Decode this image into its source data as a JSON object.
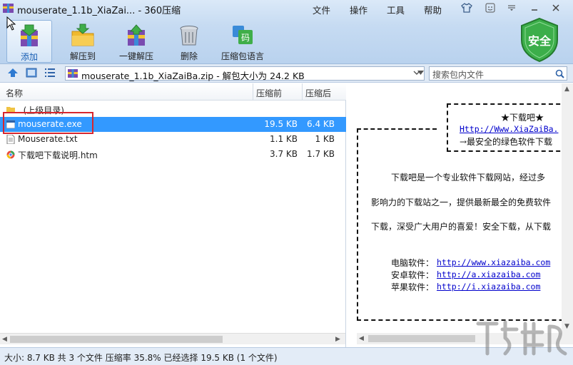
{
  "window": {
    "title": "mouserate_1.1b_XiaZai... - 360压缩",
    "menus": [
      "文件",
      "操作",
      "工具",
      "帮助"
    ]
  },
  "toolbar": {
    "buttons": [
      {
        "label": "添加",
        "icon": "add-icon"
      },
      {
        "label": "解压到",
        "icon": "extract-to-icon"
      },
      {
        "label": "一键解压",
        "icon": "one-click-extract-icon"
      },
      {
        "label": "删除",
        "icon": "delete-icon"
      },
      {
        "label": "压缩包语言",
        "icon": "archive-language-icon"
      }
    ],
    "shield_label": "安全"
  },
  "address": {
    "path": "mouserate_1.1b_XiaZaiBa.zip - 解包大小为 24.2 KB",
    "search_placeholder": "搜索包内文件"
  },
  "list": {
    "headers": {
      "name": "名称",
      "size": "压缩前",
      "csize": "压缩后"
    },
    "rows": [
      {
        "name": "..(上级目录)",
        "size": "",
        "csize": "",
        "icon": "folder-icon"
      },
      {
        "name": "mouserate.exe",
        "size": "19.5 KB",
        "csize": "6.4 KB",
        "icon": "exe-icon"
      },
      {
        "name": "Mouserate.txt",
        "size": "1.1 KB",
        "csize": "1 KB",
        "icon": "txt-icon"
      },
      {
        "name": "下载吧下载说明.htm",
        "size": "3.7 KB",
        "csize": "1.7 KB",
        "icon": "htm-icon"
      }
    ]
  },
  "preview": {
    "box_title": "★下载吧★",
    "box_url": "Http://Www.XiaZaiBa.",
    "box_slogan": "→最安全的绿色软件下载",
    "para1": "下载吧是一个专业软件下载网站，经过多",
    "para2": "影响力的下载站之一，提供最新最全的免费软件",
    "para3": "下载，深受广大用户的喜爱！安全下载，从下载",
    "links": [
      {
        "label": "电脑软件：",
        "url": "http://www.xiazaiba.com"
      },
      {
        "label": "安卓软件：",
        "url": "http://a.xiazaiba.com"
      },
      {
        "label": "苹果软件：",
        "url": "http://i.xiazaiba.com"
      }
    ]
  },
  "status": "大小: 8.7 KB 共 3 个文件 压缩率 35.8% 已经选择 19.5 KB (1 个文件)"
}
